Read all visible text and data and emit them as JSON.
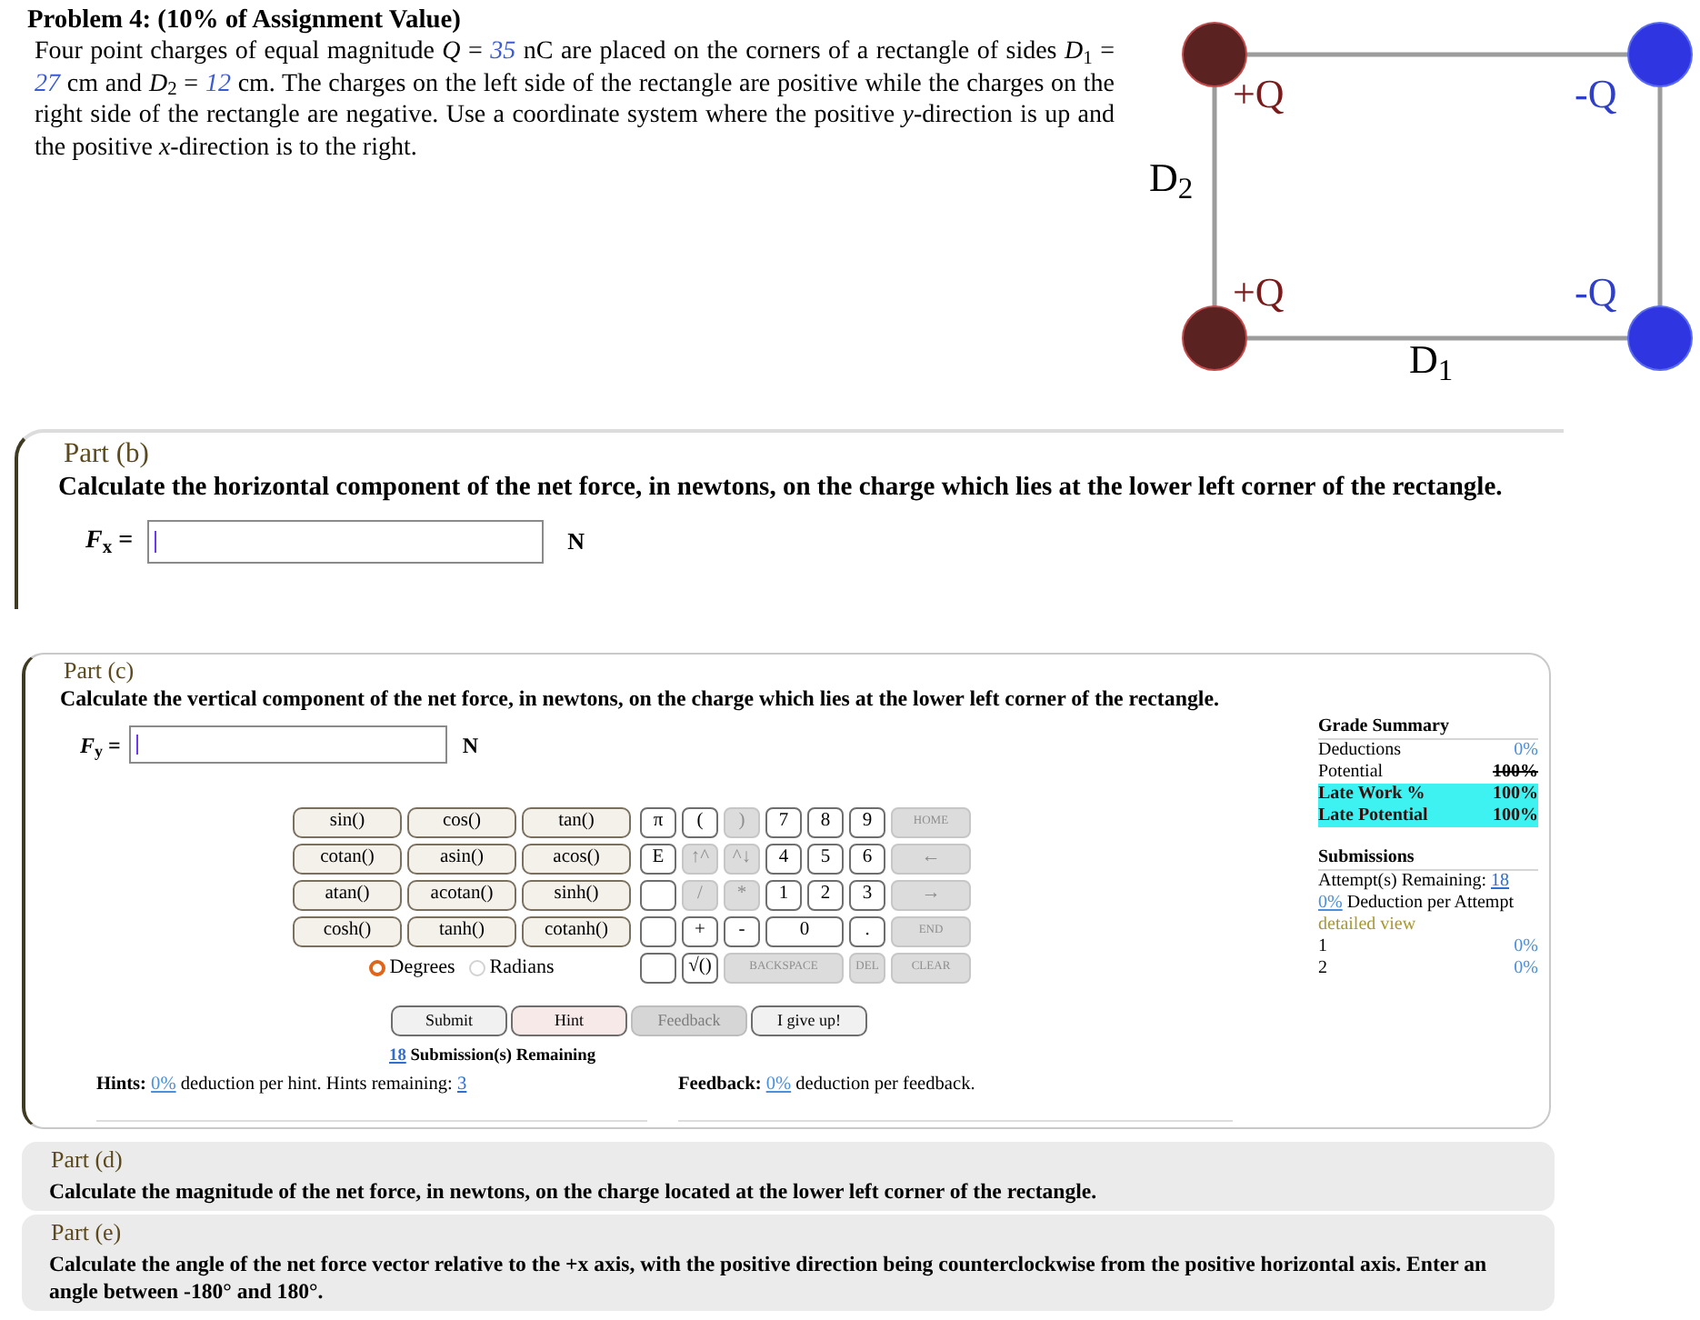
{
  "problem": {
    "title": "Problem 4: (10% of Assignment Value)",
    "statement": [
      {
        "kind": "text",
        "text": "Four point charges of equal magnitude *Q* = "
      },
      {
        "kind": "value",
        "text": "35"
      },
      {
        "kind": "text",
        "text": " nC are placed on the corners of a rectangle of sides *D*$_{1}$ = "
      },
      {
        "kind": "value",
        "text": "27"
      },
      {
        "kind": "text",
        "text": " cm and *D*$_{2}$ = "
      },
      {
        "kind": "value",
        "text": "12"
      },
      {
        "kind": "text",
        "text": " cm. The charges on the left side of the rectangle are positive while the charges on the right side of the rectangle are negative. Use a coordinate system where the positive *y*-direction is up and the positive *x*-direction is to the right."
      }
    ]
  },
  "diagram": {
    "charges": [
      {
        "kind": "positive",
        "label": "+Q"
      },
      {
        "kind": "negative",
        "label": "-Q"
      },
      {
        "kind": "positive",
        "label": "+Q"
      },
      {
        "kind": "negative",
        "label": "-Q"
      }
    ],
    "sides": [
      {
        "label": "D$_{2}$"
      },
      {
        "label": "D$_{1}$"
      }
    ]
  },
  "part_b": {
    "title": "Part (b)",
    "question": "Calculate the horizontal component of the net force, in newtons, on the charge which lies at the lower left corner of the rectangle.",
    "answer": {
      "label": "*F*$_{x}$ =",
      "unit": "N",
      "focused": true
    }
  },
  "part_c": {
    "title": "Part (c)",
    "question": "Calculate the vertical component of the net force, in newtons, on the charge which lies at the lower left corner of the rectangle.",
    "answer": {
      "label": "*F*$_{y}$ =",
      "unit": "N",
      "focused": true
    },
    "functions": [
      "sin()",
      "cos()",
      "tan()",
      "cotan()",
      "asin()",
      "acos()",
      "atan()",
      "acotan()",
      "sinh()",
      "cosh()",
      "tanh()",
      "cotanh()"
    ],
    "keys": [
      {
        "kind": "key",
        "label": "π",
        "disabled": false
      },
      {
        "kind": "key",
        "label": "(",
        "disabled": false
      },
      {
        "kind": "key",
        "label": ")",
        "disabled": true
      },
      {
        "kind": "key",
        "label": "7",
        "disabled": false
      },
      {
        "kind": "key",
        "label": "8",
        "disabled": false
      },
      {
        "kind": "key",
        "label": "9",
        "disabled": false
      },
      {
        "kind": "key",
        "label": "HOME",
        "disabled": true
      },
      {
        "kind": "key",
        "label": "E",
        "disabled": false
      },
      {
        "kind": "key",
        "label": "↑^",
        "disabled": true
      },
      {
        "kind": "key",
        "label": "^↓",
        "disabled": true
      },
      {
        "kind": "key",
        "label": "4",
        "disabled": false
      },
      {
        "kind": "key",
        "label": "5",
        "disabled": false
      },
      {
        "kind": "key",
        "label": "6",
        "disabled": false
      },
      {
        "kind": "key",
        "label": "←",
        "disabled": true
      },
      {
        "kind": "blank",
        "disabled": false
      },
      {
        "kind": "key",
        "label": "/",
        "disabled": true
      },
      {
        "kind": "key",
        "label": "*",
        "disabled": true
      },
      {
        "kind": "key",
        "label": "1",
        "disabled": false
      },
      {
        "kind": "key",
        "label": "2",
        "disabled": false
      },
      {
        "kind": "key",
        "label": "3",
        "disabled": false
      },
      {
        "kind": "key",
        "label": "→",
        "disabled": true
      },
      {
        "kind": "blank",
        "disabled": false
      },
      {
        "kind": "key",
        "label": "+",
        "disabled": false
      },
      {
        "kind": "key",
        "label": "-",
        "disabled": false
      },
      {
        "kind": "double",
        "label": "0",
        "disabled": false
      },
      {
        "kind": "key",
        "label": ".",
        "disabled": false
      },
      {
        "kind": "key",
        "label": "END",
        "disabled": true
      },
      {
        "kind": "blank",
        "disabled": false
      },
      {
        "kind": "key",
        "label": "√()",
        "disabled": false
      },
      {
        "kind": "triple",
        "label": "BACKSPACE",
        "disabled": true
      },
      {
        "kind": "key",
        "label": "DEL",
        "disabled": true
      },
      {
        "kind": "key",
        "label": "CLEAR",
        "disabled": true
      }
    ],
    "angle_modes": [
      {
        "label": "Degrees",
        "selected": true
      },
      {
        "label": "Radians",
        "selected": false
      }
    ],
    "buttons": [
      {
        "label": "Submit",
        "kind": "plain",
        "disabled": false
      },
      {
        "label": "Hint",
        "kind": "hint",
        "disabled": false
      },
      {
        "label": "Feedback",
        "kind": "plain",
        "disabled": true
      },
      {
        "label": "I give up!",
        "kind": "plain",
        "disabled": false
      }
    ],
    "submissions_remaining": {
      "count": "18",
      "label": "Submission(s) Remaining"
    },
    "hints": {
      "label": "Hints:",
      "deduction": "0%",
      "text": "deduction per hint. Hints remaining:",
      "remaining": "3"
    },
    "feedback": {
      "label": "Feedback:",
      "deduction": "0%",
      "text": "deduction per feedback."
    },
    "grade_summary": {
      "title": "Grade Summary",
      "rows": [
        {
          "label": "Deductions",
          "value": "0%",
          "link": true,
          "struck": false,
          "highlighted": false
        },
        {
          "label": "Potential",
          "value": "100%",
          "link": false,
          "struck": true,
          "highlighted": false
        },
        {
          "label": "Late Work %",
          "value": "100%",
          "link": false,
          "struck": false,
          "highlighted": true
        },
        {
          "label": "Late Potential",
          "value": "100%",
          "link": false,
          "struck": false,
          "highlighted": true
        }
      ]
    },
    "submissions": {
      "title": "Submissions",
      "remaining_label": "Attempt(s) Remaining:",
      "remaining": "18",
      "deduction": "0%",
      "deduction_label": "Deduction per Attempt",
      "detailed_view": "detailed view",
      "attempts": [
        {
          "number": "1",
          "deduction": "0%"
        },
        {
          "number": "2",
          "deduction": "0%"
        }
      ]
    }
  },
  "part_d": {
    "title": "Part (d)",
    "question": "Calculate the magnitude of the net force, in newtons, on the charge located at the lower left corner of the rectangle."
  },
  "part_e": {
    "title": "Part (e)",
    "question": "Calculate the angle of the net force vector relative to the +x axis, with the positive direction being counterclockwise from the positive horizontal axis. Enter an angle between -180° and 180°."
  }
}
